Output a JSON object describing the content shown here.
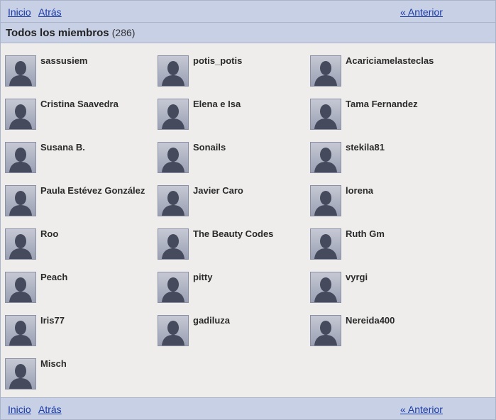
{
  "nav": {
    "home": "Inicio",
    "back": "Atrás",
    "previous": "« Anterior"
  },
  "header": {
    "title": "Todos los miembros",
    "count": "(286)"
  },
  "members": [
    "sassusiem",
    "potis_potis",
    "Acariciamelasteclas",
    "Cristina Saavedra",
    "Elena e Isa",
    "Tama Fernandez",
    "Susana B.",
    "Sonails",
    "stekila81",
    "Paula Estévez González",
    "Javier Caro",
    "lorena",
    "Roo",
    "The Beauty Codes",
    "Ruth Gm",
    "Peach",
    "pitty",
    "vyrgi",
    "Iris77",
    "gadiluza",
    "Nereida400",
    "Misch"
  ],
  "icons": {
    "avatar": "default-avatar-icon"
  },
  "colors": {
    "bar": "#c8d0e6",
    "link": "#1a3aa6",
    "background": "#eeedeb"
  }
}
